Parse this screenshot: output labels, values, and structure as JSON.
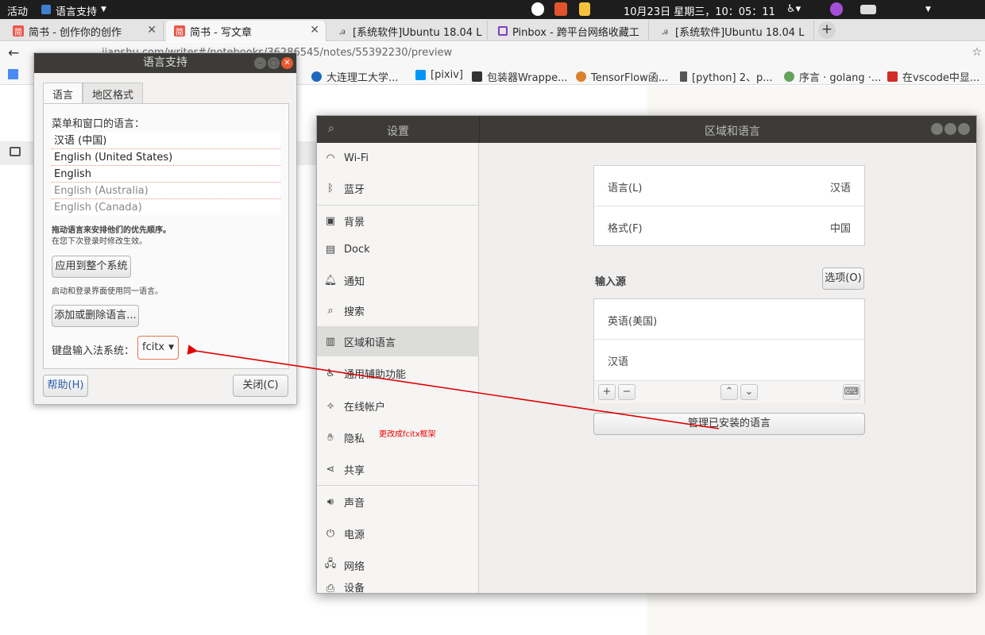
{
  "topbar": {
    "activities": "活动",
    "app_name": "语言支持",
    "datetime": "10月23日 星期三，10：05：11"
  },
  "browser": {
    "tabs": [
      {
        "title": "简书 - 创作你的创作",
        "favicon": "jianshu-icon"
      },
      {
        "title": "简书 - 写文章",
        "favicon": "jianshu-icon"
      },
      {
        "title": "[系统软件]Ubuntu 18.04 L",
        "favicon": "page-icon"
      },
      {
        "title": "Pinbox - 跨平台网络收藏工",
        "favicon": "pinbox-icon"
      },
      {
        "title": "[系统软件]Ubuntu 18.04 L",
        "favicon": "page-icon"
      }
    ],
    "url": "jianshu.com/writer#/notebooks/36286545/notes/55392230/preview",
    "bookmarks": [
      "大连理工大学...",
      "[pixiv]",
      "包装器Wrappe...",
      "TensorFlow函...",
      "[python] 2、p...",
      "序言 · golang ·...",
      "在vscode中显..."
    ]
  },
  "lang_dialog": {
    "title": "语言支持",
    "tabs": [
      "语言",
      "地区格式"
    ],
    "menu_lang_label": "菜单和窗口的语言：",
    "languages": [
      "汉语 (中国)",
      "English (United States)",
      "English",
      "English (Australia)",
      "English (Canada)"
    ],
    "drag_hint": "拖动语言来安排他们的优先顺序。",
    "effect_hint": "在您下次登录时修改生效。",
    "apply_button": "应用到整个系统",
    "apply_hint": "启动和登录界面使用同一语言。",
    "add_remove_button": "添加或删除语言...",
    "ime_label": "键盘输入法系统：",
    "ime_value": "fcitx",
    "help_button": "帮助(H)",
    "close_button": "关闭(C)"
  },
  "settings": {
    "app_title": "设置",
    "panel_title": "区域和语言",
    "sidebar": [
      {
        "label": "Wi-Fi",
        "icon": "wifi-icon"
      },
      {
        "label": "蓝牙",
        "icon": "bluetooth-icon"
      },
      {
        "label": "背景",
        "icon": "background-icon"
      },
      {
        "label": "Dock",
        "icon": "dock-icon"
      },
      {
        "label": "通知",
        "icon": "bell-icon"
      },
      {
        "label": "搜索",
        "icon": "search-icon"
      },
      {
        "label": "区域和语言",
        "icon": "region-icon"
      },
      {
        "label": "通用辅助功能",
        "icon": "accessibility-icon"
      },
      {
        "label": "在线帐户",
        "icon": "online-accounts-icon"
      },
      {
        "label": "隐私",
        "icon": "hand-icon"
      },
      {
        "label": "共享",
        "icon": "share-icon"
      },
      {
        "label": "声音",
        "icon": "speaker-icon"
      },
      {
        "label": "电源",
        "icon": "power-icon"
      },
      {
        "label": "网络",
        "icon": "network-icon"
      },
      {
        "label": "设备",
        "icon": "device-icon"
      }
    ],
    "language_label": "语言(L)",
    "language_value": "汉语",
    "formats_label": "格式(F)",
    "formats_value": "中国",
    "input_sources_label": "输入源",
    "options_button": "选项(O)",
    "input_sources": [
      "英语(美国)",
      "汉语"
    ],
    "manage_button": "管理已安装的语言"
  },
  "annotation": {
    "text": "更改成fcitx框架",
    "color": "#e00000"
  }
}
